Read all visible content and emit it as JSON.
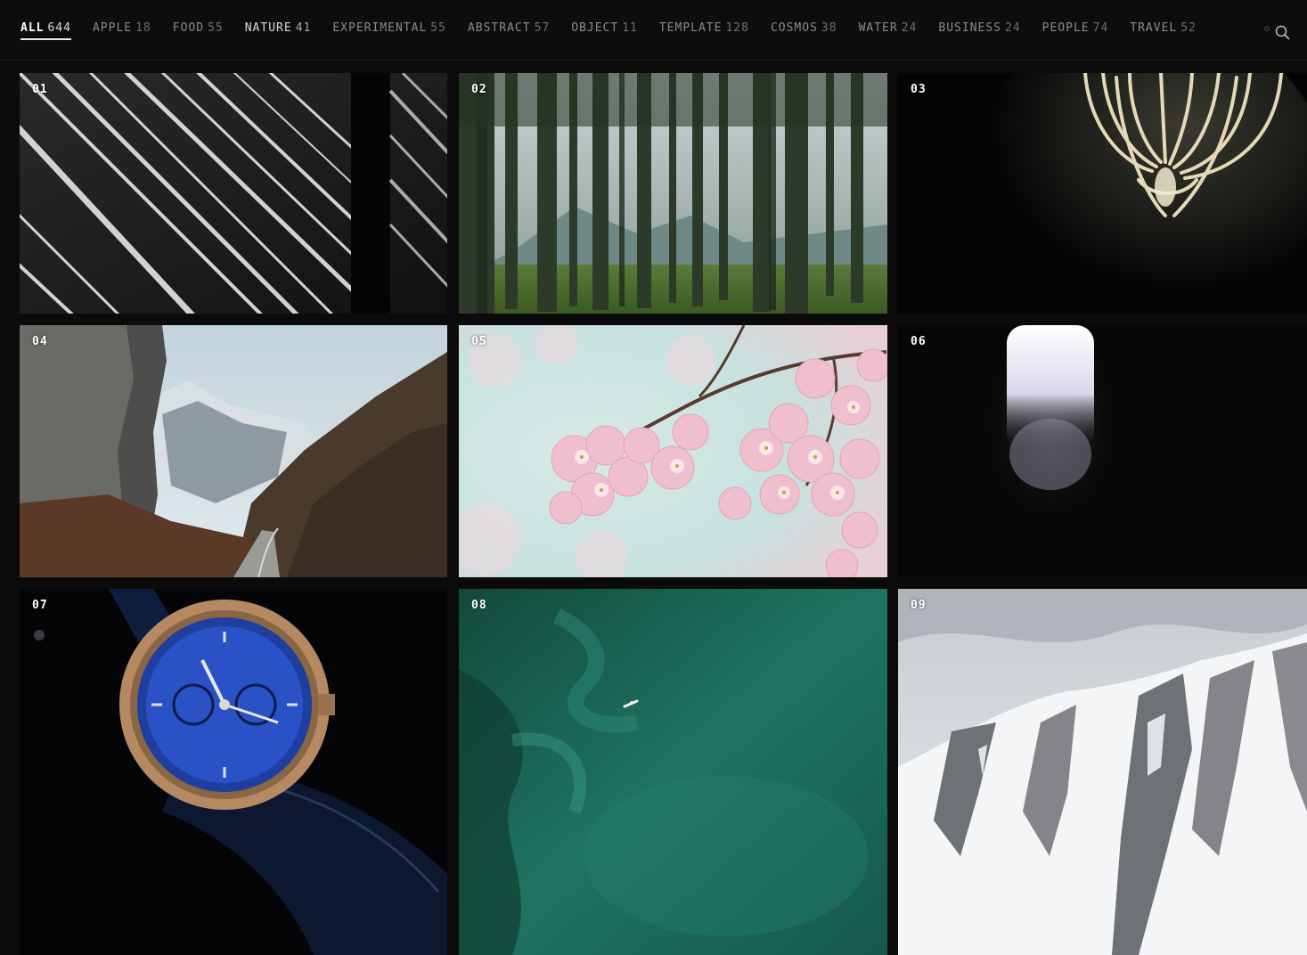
{
  "nav": {
    "tabs": [
      {
        "label": "ALL",
        "count": "644"
      },
      {
        "label": "APPLE",
        "count": "18"
      },
      {
        "label": "FOOD",
        "count": "55"
      },
      {
        "label": "NATURE",
        "count": "41"
      },
      {
        "label": "EXPERIMENTAL",
        "count": "55"
      },
      {
        "label": "ABSTRACT",
        "count": "57"
      },
      {
        "label": "OBJECT",
        "count": "11"
      },
      {
        "label": "TEMPLATE",
        "count": "128"
      },
      {
        "label": "COSMOS",
        "count": "38"
      },
      {
        "label": "WATER",
        "count": "24"
      },
      {
        "label": "BUSINESS",
        "count": "24"
      },
      {
        "label": "PEOPLE",
        "count": "74"
      },
      {
        "label": "TRAVEL",
        "count": "52"
      }
    ],
    "active_tab": "ALL",
    "search_icon": "search-icon"
  },
  "grid": {
    "tiles": [
      {
        "number": "01"
      },
      {
        "number": "02"
      },
      {
        "number": "03"
      },
      {
        "number": "04"
      },
      {
        "number": "05"
      },
      {
        "number": "06"
      },
      {
        "number": "07"
      },
      {
        "number": "08"
      },
      {
        "number": "09"
      }
    ]
  },
  "colors": {
    "background": "#0b0b0b",
    "tab_text": "#8a8a8a",
    "tab_active": "#ffffff",
    "tile_number": "#ffffff"
  }
}
